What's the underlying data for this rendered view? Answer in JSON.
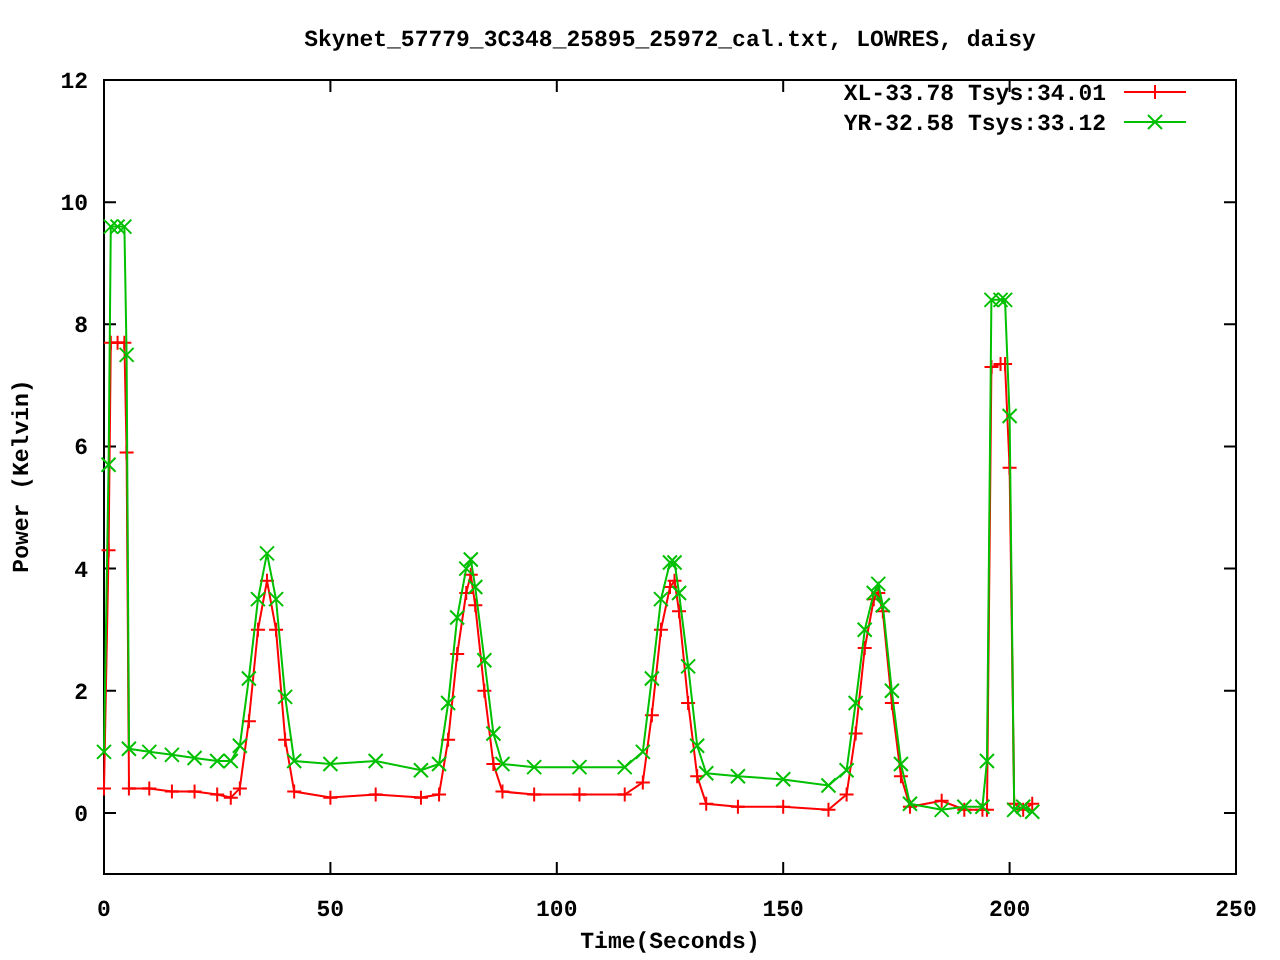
{
  "plot": {
    "chart_data": {
      "type": "line",
      "title": "Skynet_57779_3C348_25895_25972_cal.txt, LOWRES, daisy",
      "xlabel": "Time(Seconds)",
      "ylabel": "Power (Kelvin)",
      "xlim": [
        0,
        250
      ],
      "ylim": [
        -1,
        12
      ],
      "xticks": [
        0,
        50,
        100,
        150,
        200,
        250
      ],
      "yticks": [
        0,
        2,
        4,
        6,
        8,
        10,
        12
      ],
      "legend": true,
      "x": [
        0,
        1,
        1.5,
        3,
        4.5,
        5,
        5.5,
        10,
        15,
        20,
        25,
        28,
        30,
        32,
        34,
        36,
        38,
        40,
        42,
        50,
        60,
        70,
        74,
        76,
        78,
        80,
        81,
        82,
        84,
        86,
        88,
        95,
        105,
        115,
        119,
        121,
        123,
        125,
        126,
        127,
        129,
        131,
        133,
        140,
        150,
        160,
        164,
        166,
        168,
        170,
        171,
        172,
        174,
        176,
        178,
        185,
        190,
        194,
        195,
        196,
        198,
        199,
        200,
        201,
        203,
        205
      ],
      "series": [
        {
          "name": "XL-33.78 Tsys:34.01",
          "color": "#ff0000",
          "marker": "plus",
          "values": [
            0.4,
            4.3,
            7.7,
            7.7,
            7.7,
            5.9,
            0.4,
            0.4,
            0.35,
            0.35,
            0.3,
            0.25,
            0.4,
            1.5,
            3.0,
            3.8,
            3.0,
            1.2,
            0.35,
            0.25,
            0.3,
            0.25,
            0.3,
            1.2,
            2.6,
            3.6,
            3.9,
            3.4,
            2.0,
            0.8,
            0.35,
            0.3,
            0.3,
            0.3,
            0.5,
            1.6,
            3.0,
            3.7,
            3.8,
            3.3,
            1.8,
            0.6,
            0.15,
            0.1,
            0.1,
            0.05,
            0.3,
            1.3,
            2.7,
            3.5,
            3.6,
            3.3,
            1.8,
            0.6,
            0.1,
            0.2,
            0.05,
            0.05,
            0.05,
            7.3,
            7.35,
            7.35,
            5.65,
            0.15,
            0.05,
            0.15
          ]
        },
        {
          "name": "YR-32.58 Tsys:33.12",
          "color": "#00c000",
          "marker": "cross",
          "values": [
            1.0,
            5.7,
            9.6,
            9.6,
            9.6,
            7.5,
            1.05,
            1.0,
            0.95,
            0.9,
            0.85,
            0.85,
            1.1,
            2.2,
            3.5,
            4.25,
            3.5,
            1.9,
            0.85,
            0.8,
            0.85,
            0.7,
            0.8,
            1.8,
            3.2,
            4.0,
            4.15,
            3.7,
            2.5,
            1.3,
            0.8,
            0.75,
            0.75,
            0.75,
            1.0,
            2.2,
            3.5,
            4.1,
            4.1,
            3.6,
            2.4,
            1.1,
            0.65,
            0.6,
            0.55,
            0.45,
            0.7,
            1.8,
            3.0,
            3.6,
            3.75,
            3.4,
            2.0,
            0.8,
            0.15,
            0.05,
            0.1,
            0.1,
            0.85,
            8.4,
            8.4,
            8.4,
            6.5,
            0.05,
            0.1,
            0.02
          ]
        }
      ]
    }
  }
}
